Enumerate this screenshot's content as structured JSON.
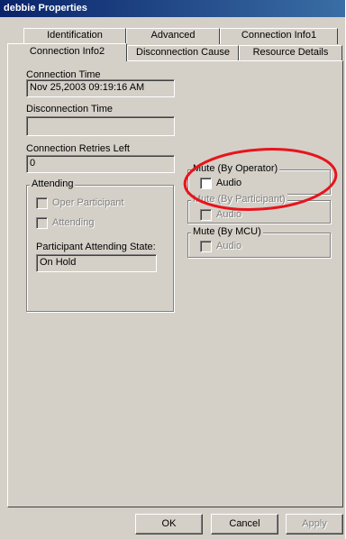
{
  "window": {
    "title": "debbie Properties"
  },
  "tabs": {
    "row1": [
      "Identification",
      "Advanced",
      "Connection Info1"
    ],
    "row2": [
      "Connection Info2",
      "Disconnection Cause",
      "Resource Details"
    ],
    "active": "Connection Info2"
  },
  "fields": {
    "connection_time_label": "Connection Time",
    "connection_time_value": "Nov 25,2003  09:19:16 AM",
    "disconnection_time_label": "Disconnection Time",
    "disconnection_time_value": "",
    "retries_label": "Connection Retries Left",
    "retries_value": "0"
  },
  "attending": {
    "legend": "Attending",
    "oper_participant": "Oper Participant",
    "attending": "Attending",
    "state_label": "Participant Attending State:",
    "state_value": "On Hold"
  },
  "mute_operator": {
    "legend": "Mute (By Operator)",
    "audio": "Audio"
  },
  "mute_participant": {
    "legend": "Mute (By Participant)",
    "audio": "Audio"
  },
  "mute_mcu": {
    "legend": "Mute (By MCU)",
    "audio": "Audio"
  },
  "buttons": {
    "ok": "OK",
    "cancel": "Cancel",
    "apply": "Apply"
  },
  "annotation": {
    "color": "#e8141c"
  }
}
